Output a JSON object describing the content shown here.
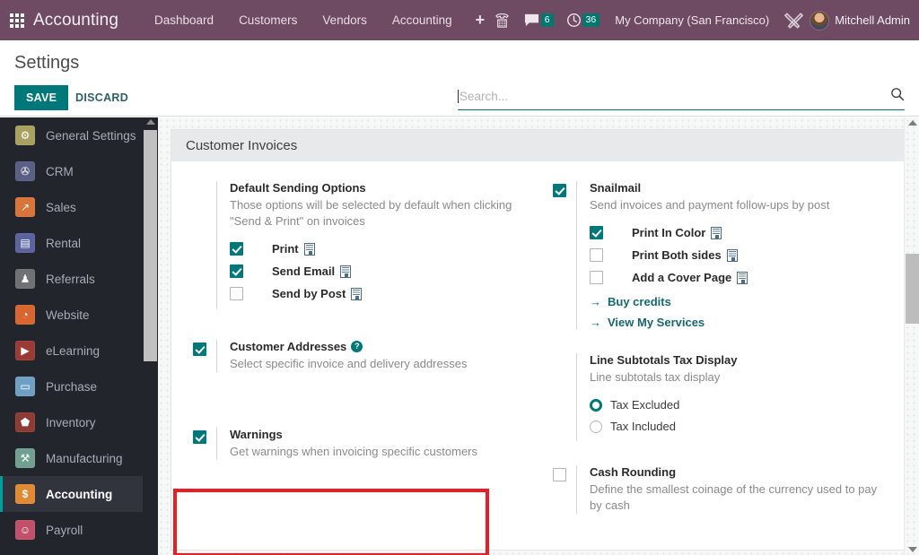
{
  "topnav": {
    "apps_icon": "apps-grid-icon",
    "brand": "Accounting",
    "menu": [
      {
        "label": "Dashboard"
      },
      {
        "label": "Customers"
      },
      {
        "label": "Vendors"
      },
      {
        "label": "Accounting"
      },
      {
        "label": "+"
      }
    ],
    "phone_icon": "phone-dialpad-icon",
    "messages": {
      "icon": "chat-bubble-icon",
      "count": "6"
    },
    "activities": {
      "icon": "clock-icon",
      "count": "36"
    },
    "company": "My Company (San Francisco)",
    "tools_icon": "tools-wrench-screwdriver-icon",
    "avatar_icon": "user-avatar",
    "username": "Mitchell Admin",
    "accent": "#6e4a63",
    "badge_color": "#00786f"
  },
  "controlpanel": {
    "title": "Settings",
    "save_label": "SAVE",
    "discard_label": "DISCARD",
    "save_color": "#00787a"
  },
  "search": {
    "placeholder": "Search...",
    "value": "",
    "icon": "magnifier-icon"
  },
  "sidebar": {
    "items": [
      {
        "label": "General Settings",
        "icon": "gear-icon",
        "color": "#a8a15f",
        "glyph": "⚙",
        "active": false
      },
      {
        "label": "CRM",
        "icon": "handshake-icon",
        "color": "#5a5f86",
        "glyph": "☬",
        "active": false
      },
      {
        "label": "Sales",
        "icon": "chart-up-icon",
        "color": "#d9743a",
        "glyph": "↗",
        "active": false
      },
      {
        "label": "Rental",
        "icon": "calendar-icon",
        "color": "#5c63a0",
        "glyph": "▤",
        "active": false
      },
      {
        "label": "Referrals",
        "icon": "gift-icon",
        "color": "#6e7275",
        "glyph": "♟",
        "active": false
      },
      {
        "label": "Website",
        "icon": "globe-icon",
        "color": "#d9652f",
        "glyph": "◔",
        "active": false
      },
      {
        "label": "eLearning",
        "icon": "presentation-icon",
        "color": "#9a3b36",
        "glyph": "▶",
        "active": false
      },
      {
        "label": "Purchase",
        "icon": "card-icon",
        "color": "#6fa0c4",
        "glyph": "▭",
        "active": false
      },
      {
        "label": "Inventory",
        "icon": "box-icon",
        "color": "#8f3b33",
        "glyph": "⬟",
        "active": false
      },
      {
        "label": "Manufacturing",
        "icon": "wrench-icon",
        "color": "#71a090",
        "glyph": "⚒",
        "active": false
      },
      {
        "label": "Accounting",
        "icon": "invoice-icon",
        "color": "#e08a33",
        "glyph": "$",
        "active": true
      },
      {
        "label": "Payroll",
        "icon": "person-badge-icon",
        "color": "#c2506b",
        "glyph": "☺",
        "active": false
      }
    ],
    "active_accent": "#00a09d"
  },
  "settings": {
    "section_title": "Customer Invoices",
    "left": {
      "default_sending": {
        "title": "Default Sending Options",
        "desc": "Those options will be selected by default when clicking \"Send & Print\" on invoices",
        "options": [
          {
            "label": "Print",
            "checked": true,
            "company_icon": "company-building-icon"
          },
          {
            "label": "Send Email",
            "checked": true,
            "company_icon": "company-building-icon"
          },
          {
            "label": "Send by Post",
            "checked": false,
            "company_icon": "company-building-icon"
          }
        ]
      },
      "customer_addresses": {
        "title": "Customer Addresses",
        "desc": "Select specific invoice and delivery addresses",
        "checked": true,
        "help_icon": "question-mark-icon",
        "help_glyph": "?"
      },
      "warnings": {
        "title": "Warnings",
        "desc": "Get warnings when invoicing specific customers",
        "checked": true,
        "highlighted": true,
        "highlight_color": "#ec1c24"
      }
    },
    "right": {
      "snailmail": {
        "title": "Snailmail",
        "desc": "Send invoices and payment follow-ups by post",
        "checked": true,
        "options": [
          {
            "label": "Print In Color",
            "checked": true,
            "company_icon": "company-building-icon"
          },
          {
            "label": "Print Both sides",
            "checked": false,
            "company_icon": "company-building-icon"
          },
          {
            "label": "Add a Cover Page",
            "checked": false,
            "company_icon": "company-building-icon"
          }
        ],
        "links": [
          {
            "label": "Buy credits",
            "arrow": "→"
          },
          {
            "label": "View My Services",
            "arrow": "→"
          }
        ]
      },
      "line_subtotals": {
        "title": "Line Subtotals Tax Display",
        "desc": "Line subtotals tax display",
        "options": [
          {
            "label": "Tax Excluded",
            "selected": true
          },
          {
            "label": "Tax Included",
            "selected": false
          }
        ]
      },
      "cash_rounding": {
        "title": "Cash Rounding",
        "desc": "Define the smallest coinage of the currency used to pay by cash",
        "checked": false
      }
    }
  }
}
